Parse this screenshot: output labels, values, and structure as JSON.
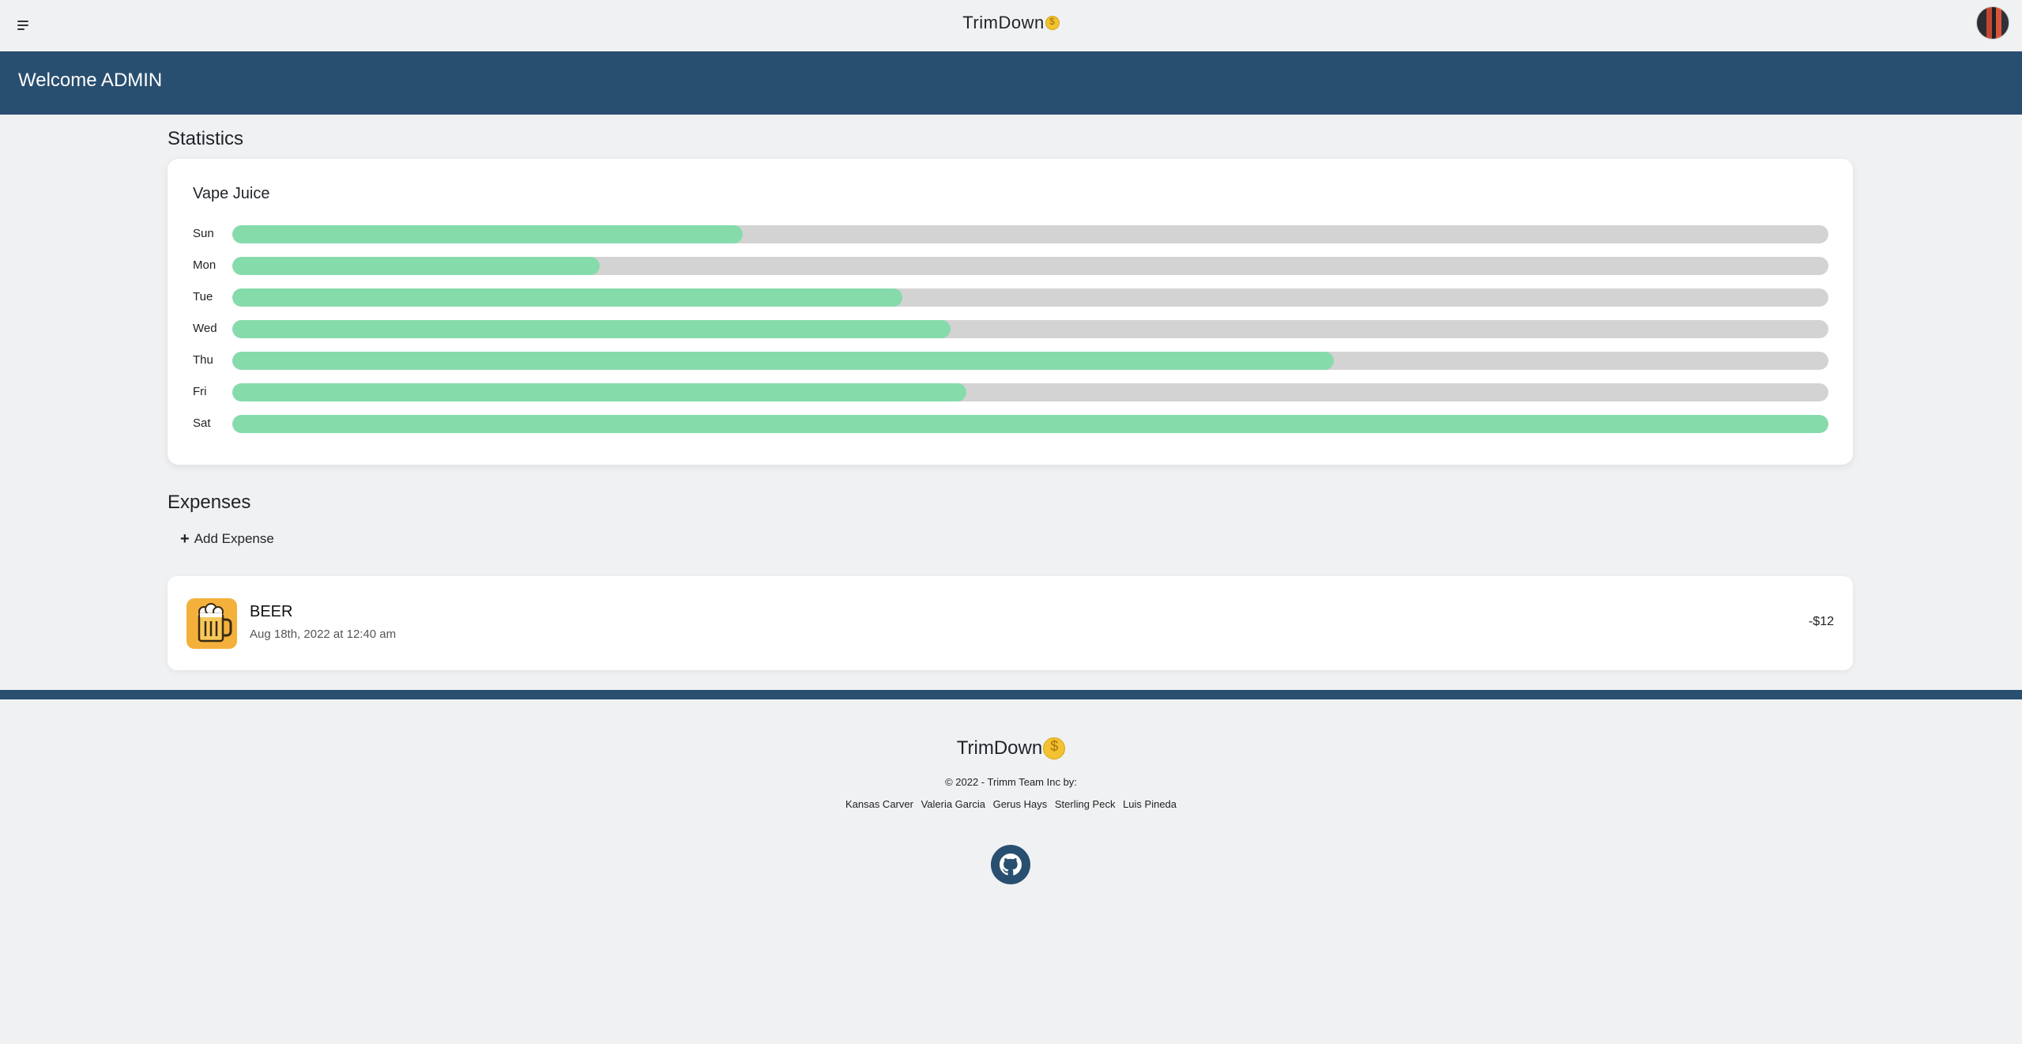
{
  "app": {
    "title": "TrimDown",
    "brand_colors": {
      "primary": "#294f70",
      "accent_green": "#86dbab",
      "coin": "#f2c230"
    }
  },
  "topbar": {
    "menu_icon": "hamburger-menu-icon",
    "avatar_icon": "user-avatar"
  },
  "welcome": {
    "text": "Welcome ADMIN"
  },
  "statistics": {
    "title": "Statistics",
    "card_title": "Vape Juice",
    "chart_data": {
      "type": "bar",
      "orientation": "horizontal",
      "categories": [
        "Sun",
        "Mon",
        "Tue",
        "Wed",
        "Thu",
        "Fri",
        "Sat"
      ],
      "values": [
        0.32,
        0.23,
        0.42,
        0.45,
        0.69,
        0.46,
        1.0
      ]
    }
  },
  "expenses": {
    "title": "Expenses",
    "add_label": "Add Expense",
    "items": [
      {
        "name": "BEER",
        "date": "Aug 18th, 2022 at 12:40 am",
        "amount": "-$12",
        "icon": "beer-mug-icon",
        "icon_bg": "#f3b13c"
      }
    ]
  },
  "footer": {
    "brand": "TrimDown",
    "copyright": "© 2022 - Trimm Team Inc by:",
    "team": [
      "Kansas Carver",
      "Valeria Garcia",
      "Gerus Hays",
      "Sterling Peck",
      "Luis Pineda"
    ],
    "github_icon": "github-icon"
  }
}
